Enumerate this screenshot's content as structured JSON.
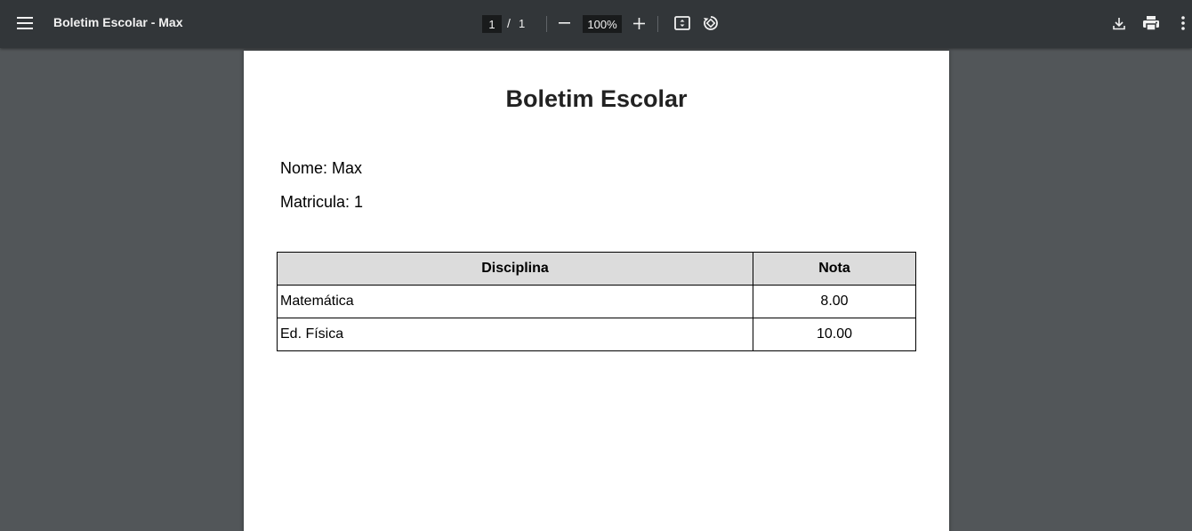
{
  "toolbar": {
    "menu_icon": "hamburger-menu-icon",
    "title": "Boletim Escolar - Max",
    "current_page": "1",
    "page_separator": "/",
    "total_pages": "1",
    "zoom_out_icon": "minus-icon",
    "zoom_level": "100%",
    "zoom_in_icon": "plus-icon",
    "fit_icon": "fit-to-page-icon",
    "rotate_icon": "rotate-counterclockwise-icon",
    "download_icon": "download-icon",
    "print_icon": "print-icon",
    "more_icon": "more-vertical-icon",
    "colors": {
      "toolbar_bg": "#323639",
      "viewer_bg": "#525659",
      "input_bg": "#191b1c"
    }
  },
  "document": {
    "title": "Boletim Escolar",
    "name_line": "Nome: Max",
    "registration_line": "Matricula: 1",
    "table": {
      "headers": [
        "Disciplina",
        "Nota"
      ],
      "rows": [
        [
          "Matemática",
          "8.00"
        ],
        [
          "Ed. Física",
          "10.00"
        ]
      ],
      "header_bg": "#dcdcdc"
    }
  }
}
